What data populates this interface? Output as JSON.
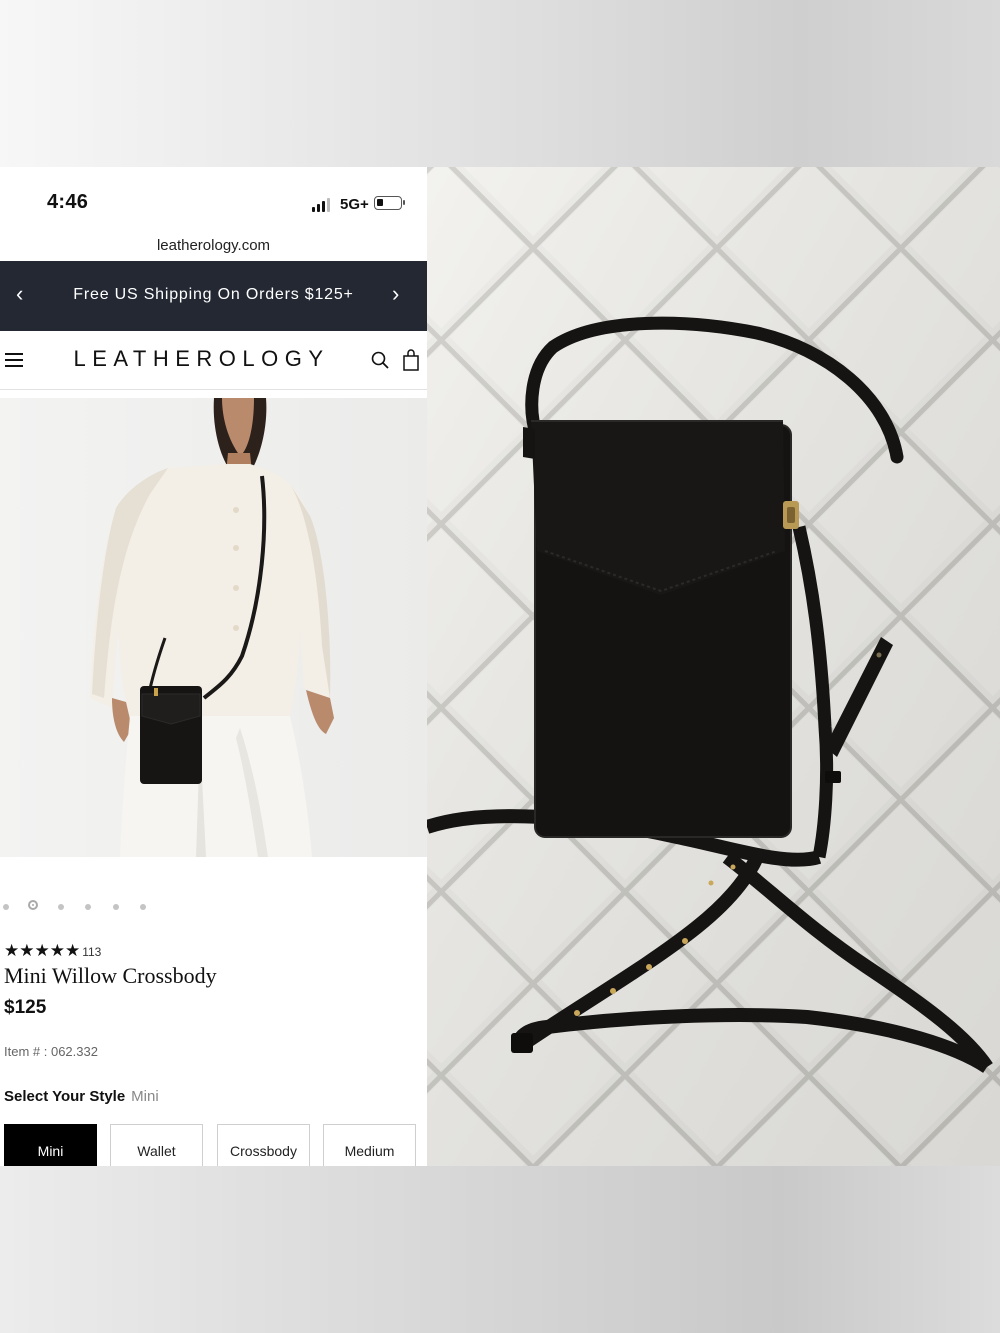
{
  "status_bar": {
    "time": "4:46",
    "network": "5G+"
  },
  "browser": {
    "url": "leatherology.com"
  },
  "promo_banner": {
    "text": "Free US Shipping On Orders $125+",
    "prev_icon": "chevron-left-icon",
    "next_icon": "chevron-right-icon"
  },
  "header": {
    "logo": "LEATHEROLOGY",
    "icons": [
      "menu-icon",
      "search-icon",
      "shopping-bag-icon"
    ]
  },
  "gallery": {
    "dot_count": 6,
    "active_index": 1
  },
  "product": {
    "stars": "★★★★★",
    "rating": 5,
    "review_count": "113",
    "title": "Mini Willow Crossbody",
    "price": "$125",
    "item_number": "Item # : 062.332"
  },
  "style_selector": {
    "label": "Select Your Style",
    "selected": "Mini",
    "options": [
      "Mini",
      "Wallet",
      "Crossbody",
      "Medium"
    ]
  },
  "colors": {
    "promo_bg": "#232833",
    "selected_button": "#000000",
    "bag_leather": "#141312",
    "quilt_fabric": "#e9e8e3"
  }
}
